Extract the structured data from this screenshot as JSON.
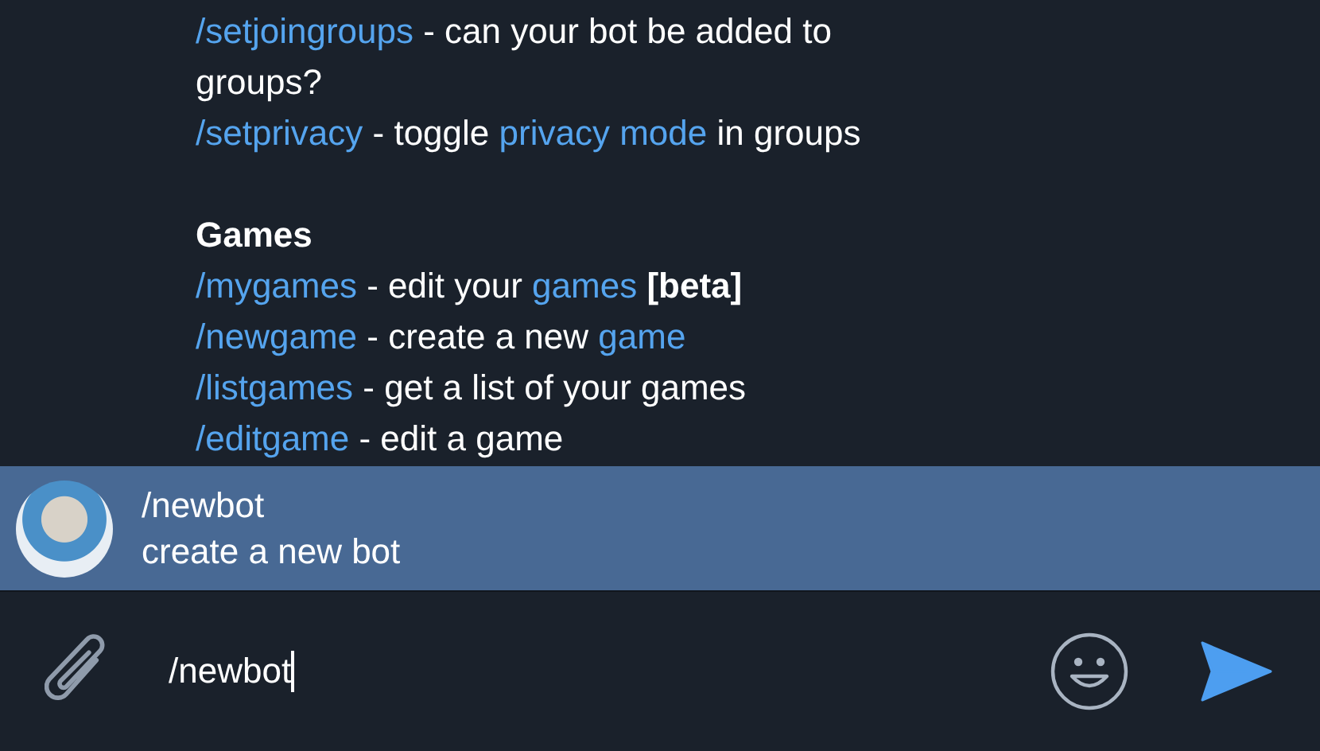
{
  "messages": [
    {
      "kind": "command",
      "command": "/setjoingroups",
      "parts": [
        {
          "kind": "plain",
          "text": " - can your bot be added to groups?"
        }
      ]
    },
    {
      "kind": "command",
      "command": "/setprivacy",
      "parts": [
        {
          "kind": "plain",
          "text": " - toggle "
        },
        {
          "kind": "link",
          "text": "privacy mode"
        },
        {
          "kind": "plain",
          "text": " in groups"
        }
      ]
    },
    {
      "kind": "blank"
    },
    {
      "kind": "heading",
      "text": "Games"
    },
    {
      "kind": "command",
      "command": "/mygames",
      "parts": [
        {
          "kind": "plain",
          "text": " - edit your "
        },
        {
          "kind": "link",
          "text": "games"
        },
        {
          "kind": "bold",
          "text": "[beta]"
        }
      ]
    },
    {
      "kind": "command",
      "command": "/newgame",
      "parts": [
        {
          "kind": "plain",
          "text": " - create a new "
        },
        {
          "kind": "link",
          "text": "game"
        }
      ]
    },
    {
      "kind": "command",
      "command": "/listgames",
      "parts": [
        {
          "kind": "plain",
          "text": " - get a list of your games"
        }
      ]
    },
    {
      "kind": "command",
      "command": "/editgame",
      "parts": [
        {
          "kind": "plain",
          "text": " - edit a game"
        }
      ]
    }
  ],
  "suggestion": {
    "command": "/newbot",
    "description": "create a new bot",
    "selected": true
  },
  "composer": {
    "value": "/newbot"
  }
}
